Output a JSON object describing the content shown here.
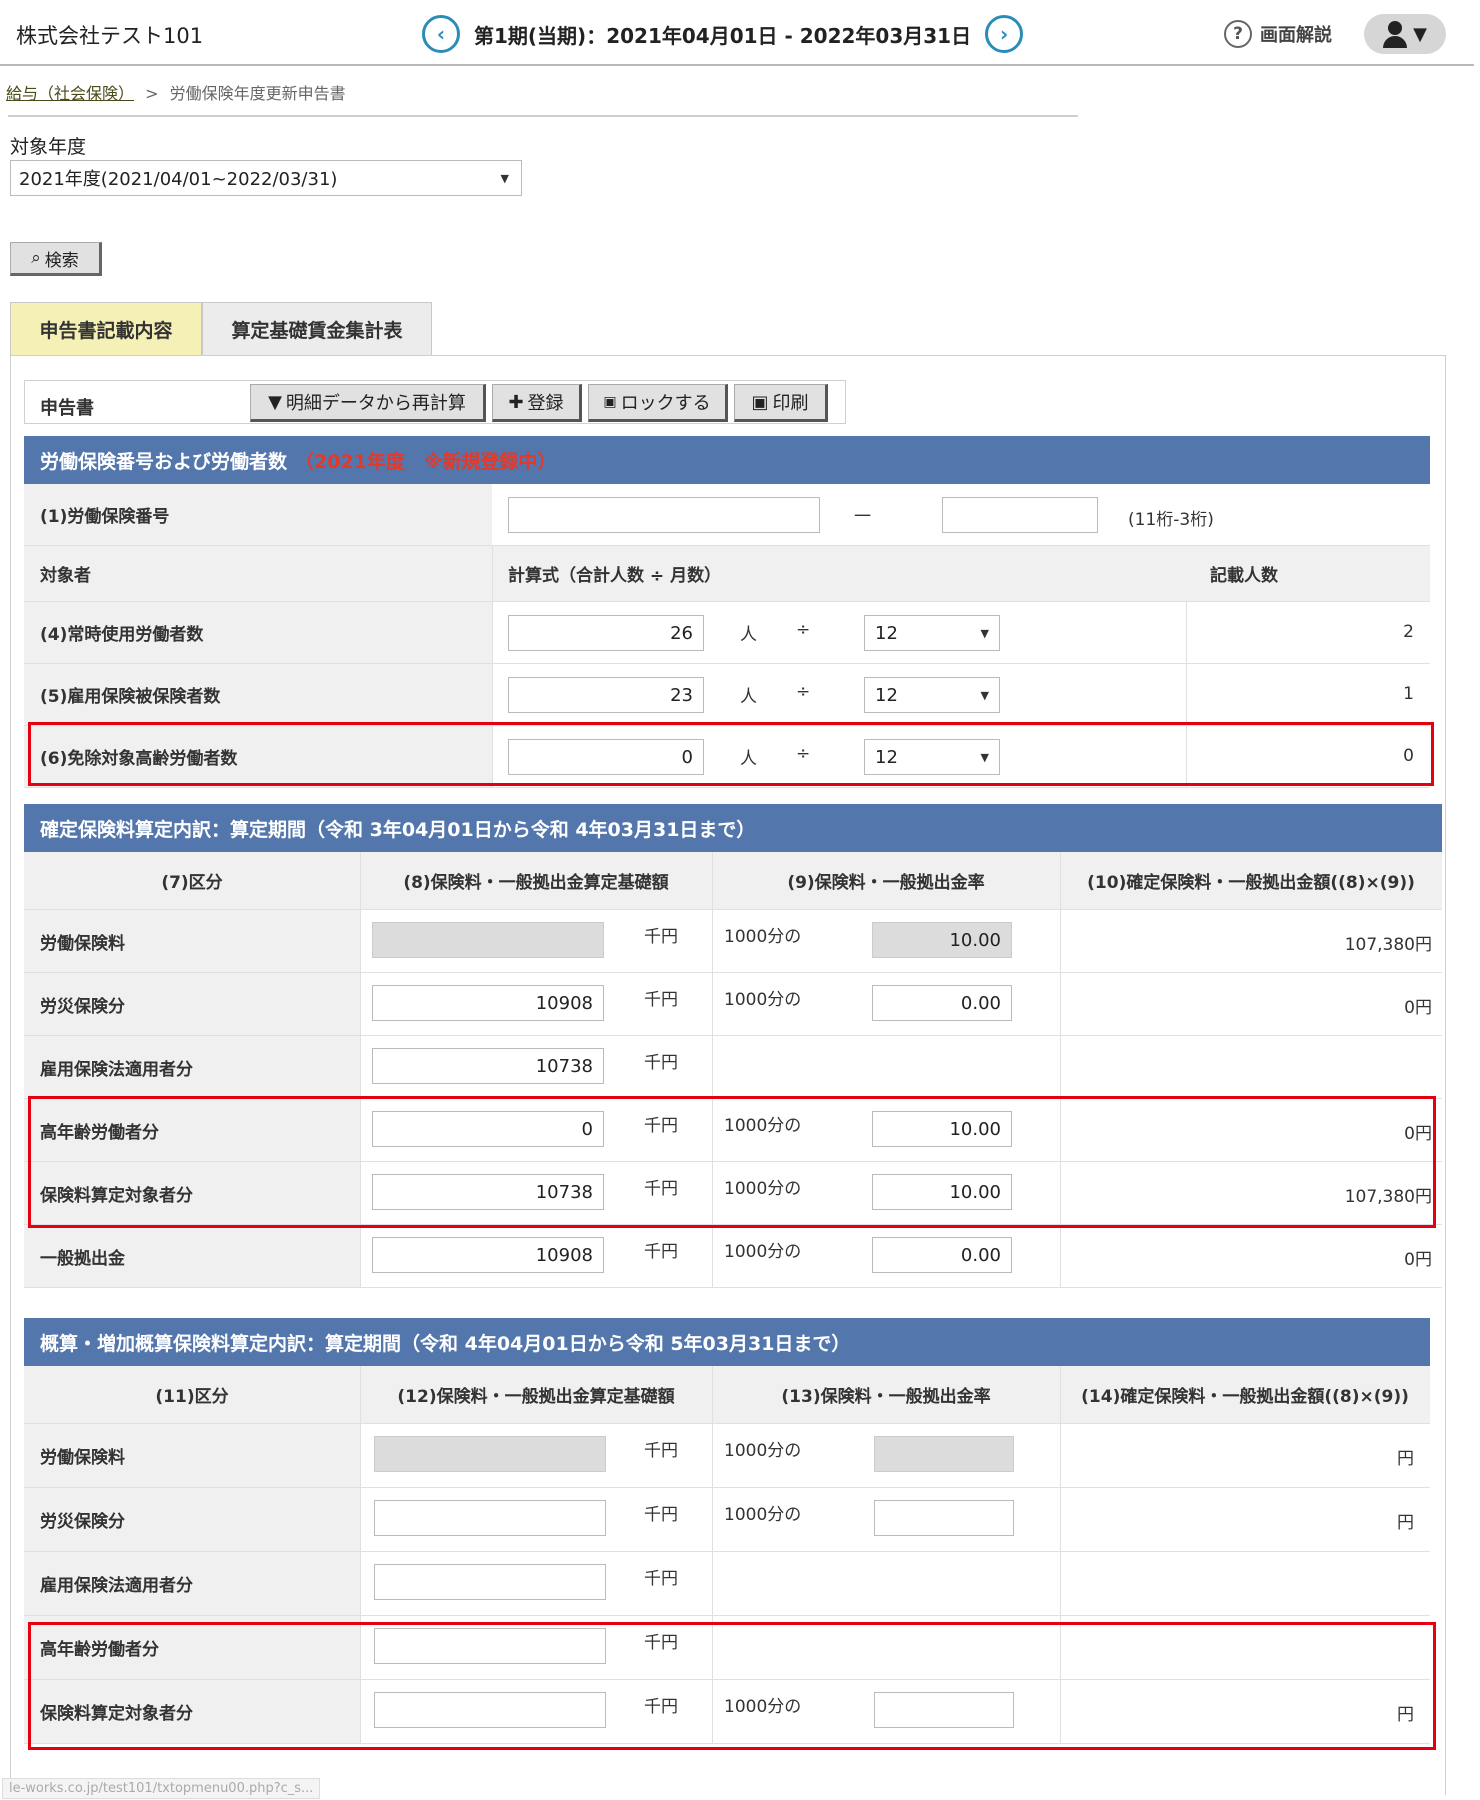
{
  "header": {
    "company": "株式会社テスト101",
    "period": "第1期(当期)：2021年04月01日 - 2022年03月31日",
    "prev_icon": "‹",
    "next_icon": "›",
    "help_label": "画面解説",
    "help_icon": "?",
    "user_caret": "▼"
  },
  "breadcrumb": {
    "parent": "給与（社会保険）",
    "separator": ">",
    "current": "労働保険年度更新申告書"
  },
  "filter": {
    "year_label": "対象年度",
    "year_value": "2021年度(2021/04/01~2022/03/31)",
    "search_label": "検索",
    "search_icon": "⌕"
  },
  "tabs": [
    {
      "label": "申告書記載内容"
    },
    {
      "label": "算定基礎賃金集計表"
    }
  ],
  "toolbar": {
    "label": "申告書",
    "recalc": "明細データから再計算",
    "recalc_icon": "▼",
    "register": "登録",
    "register_icon": "✚",
    "lock": "ロックする",
    "lock_icon": "🔒",
    "print": "印刷",
    "print_icon": "▣"
  },
  "section1": {
    "title": "労働保険番号および労働者数",
    "status": "（2021年度　※新規登録中）",
    "insurance_no_label": "(1)労働保険番号",
    "dash": "一",
    "digits_hint": "(11桁-3桁)",
    "col_target": "対象者",
    "col_formula": "計算式（合計人数 ÷ 月数）",
    "col_count": "記載人数",
    "unit_person": "人",
    "div": "÷",
    "rows": [
      {
        "label": "(4)常時使用労働者数",
        "total": "26",
        "months": "12",
        "count": "2"
      },
      {
        "label": "(5)雇用保険被保険者数",
        "total": "23",
        "months": "12",
        "count": "1"
      },
      {
        "label": "(6)免除対象高齢労働者数",
        "total": "0",
        "months": "12",
        "count": "0"
      }
    ]
  },
  "section2": {
    "title": "確定保険料算定内訳：算定期間（令和 3年04月01日から令和 4年03月31日まで）",
    "headers": [
      "(7)区分",
      "(8)保険料・一般拠出金算定基礎額",
      "(9)保険料・一般拠出金率",
      "(10)確定保険料・一般拠出金額((8)×(9))"
    ],
    "unit_thousand": "千円",
    "rate_prefix": "1000分の",
    "rows": [
      {
        "label": "労働保険料",
        "base": "",
        "rate": "10.00",
        "amount": "107,380円"
      },
      {
        "label": "労災保険分",
        "base": "10908",
        "rate": "0.00",
        "amount": "0円"
      },
      {
        "label": "雇用保険法適用者分",
        "base": "10738",
        "rate": "",
        "amount": ""
      },
      {
        "label": "高年齢労働者分",
        "base": "0",
        "rate": "10.00",
        "amount": "0円"
      },
      {
        "label": "保険料算定対象者分",
        "base": "10738",
        "rate": "10.00",
        "amount": "107,380円"
      },
      {
        "label": "一般拠出金",
        "base": "10908",
        "rate": "0.00",
        "amount": "0円"
      }
    ]
  },
  "section3": {
    "title": "概算・増加概算保険料算定内訳：算定期間（令和 4年04月01日から令和 5年03月31日まで）",
    "headers": [
      "(11)区分",
      "(12)保険料・一般拠出金算定基礎額",
      "(13)保険料・一般拠出金率",
      "(14)確定保険料・一般拠出金額((8)×(9))"
    ],
    "unit_thousand": "千円",
    "rate_prefix": "1000分の",
    "yen": "円",
    "rows": [
      {
        "label": "労働保険料"
      },
      {
        "label": "労災保険分"
      },
      {
        "label": "雇用保険法適用者分"
      },
      {
        "label": "高年齢労働者分"
      },
      {
        "label": "保険料算定対象者分"
      }
    ]
  },
  "status_url": "le-works.co.jp/test101/txtopmenu00.php?c_s..."
}
